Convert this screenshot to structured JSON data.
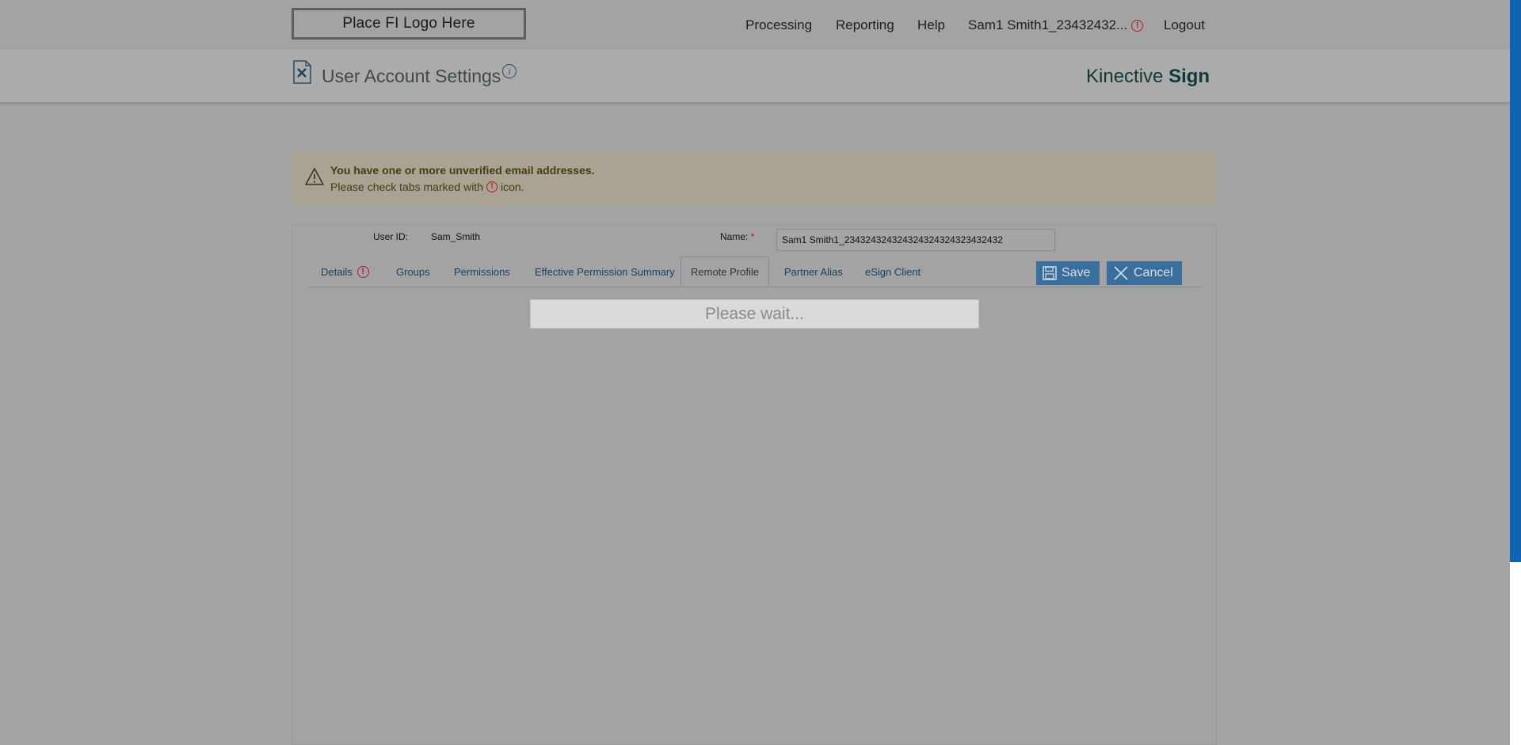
{
  "header": {
    "logo_text": "Place FI Logo Here",
    "nav": {
      "processing": "Processing",
      "reporting": "Reporting",
      "help": "Help",
      "user": "Sam1 Smith1_23432432...",
      "logout": "Logout"
    }
  },
  "subheader": {
    "title": "User Account Settings",
    "brand_light": "Kinective ",
    "brand_bold": "Sign"
  },
  "alert": {
    "line1": "You have one or more unverified email addresses.",
    "line2_before": "Please check tabs marked with",
    "line2_after": "icon."
  },
  "form": {
    "user_id_label": "User ID:",
    "user_id_value": "Sam_Smith",
    "name_label": "Name:",
    "name_required": "*",
    "name_value": "Sam1 Smith1_234324324324324324324323432432"
  },
  "tabs": [
    {
      "label": "Details"
    },
    {
      "label": "Groups"
    },
    {
      "label": "Permissions"
    },
    {
      "label": "Effective Permission Summary"
    },
    {
      "label": "Remote Profile"
    },
    {
      "label": "Partner Alias"
    },
    {
      "label": "eSign Client"
    }
  ],
  "active_tab": "Remote Profile",
  "buttons": {
    "save": "Save",
    "cancel": "Cancel"
  },
  "loading_text": "Please wait...",
  "colors": {
    "overlay_gray": "#a3a3a3",
    "button_blue": "#3a6e9c",
    "error_red": "#b11c1c",
    "accent_blue": "#0f63b3"
  }
}
